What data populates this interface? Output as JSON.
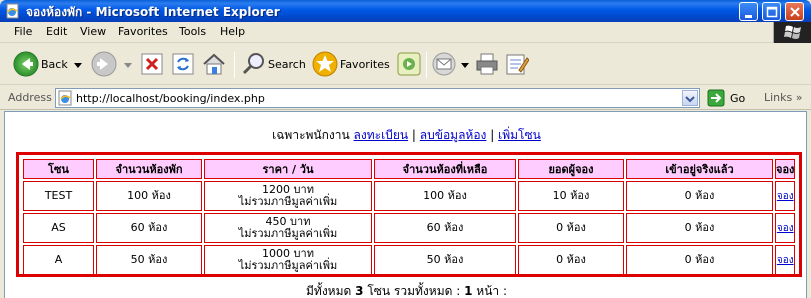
{
  "window": {
    "title": "จองห้องพัก - Microsoft Internet Explorer"
  },
  "menu": [
    "File",
    "Edit",
    "View",
    "Favorites",
    "Tools",
    "Help"
  ],
  "toolbar": {
    "back_label": "Back",
    "search_label": "Search",
    "favorites_label": "Favorites"
  },
  "address": {
    "label": "Address",
    "url": "http://localhost/booking/index.php",
    "go_label": "Go",
    "links_label": "Links"
  },
  "nav": {
    "prefix": "เฉพาะพนักงาน",
    "link1": "ลงทะเบียน",
    "sep1": "|",
    "link2": "ลบข้อมูลห้อง",
    "sep2": "|",
    "link3": "เพิ่มโซน"
  },
  "table": {
    "headers": [
      "โซน",
      "จำนวนห้องพัก",
      "ราคา / วัน",
      "จำนวนห้องที่เหลือ",
      "ยอดผู้จอง",
      "เข้าอยู่จริงแล้ว",
      "จอง"
    ],
    "rows": [
      {
        "zone": "TEST",
        "rooms": "100 ห้อง",
        "price": "1200 บาท",
        "price_note": "ไม่รวมภาษีมูลค่าเพิ่ม",
        "remaining": "100 ห้อง",
        "bookings": "10 ห้อง",
        "checked_in": "0 ห้อง",
        "action": "จอง"
      },
      {
        "zone": "AS",
        "rooms": "60 ห้อง",
        "price": "450 บาท",
        "price_note": "ไม่รวมภาษีมูลค่าเพิ่ม",
        "remaining": "60 ห้อง",
        "bookings": "0 ห้อง",
        "checked_in": "0 ห้อง",
        "action": "จอง"
      },
      {
        "zone": "A",
        "rooms": "50 ห้อง",
        "price": "1000 บาท",
        "price_note": "ไม่รวมภาษีมูลค่าเพิ่ม",
        "remaining": "50 ห้อง",
        "bookings": "0 ห้อง",
        "checked_in": "0 ห้อง",
        "action": "จอง"
      }
    ]
  },
  "footer": {
    "part1": "มีทั้งหมด",
    "zones": "3",
    "part2": "โซน รวมทั้งหมด :",
    "pages": "1",
    "part3": "หน้า :"
  },
  "colors": {
    "table_border": "#dd0000",
    "header_bg": "#ffccff",
    "link": "#0000cc"
  }
}
